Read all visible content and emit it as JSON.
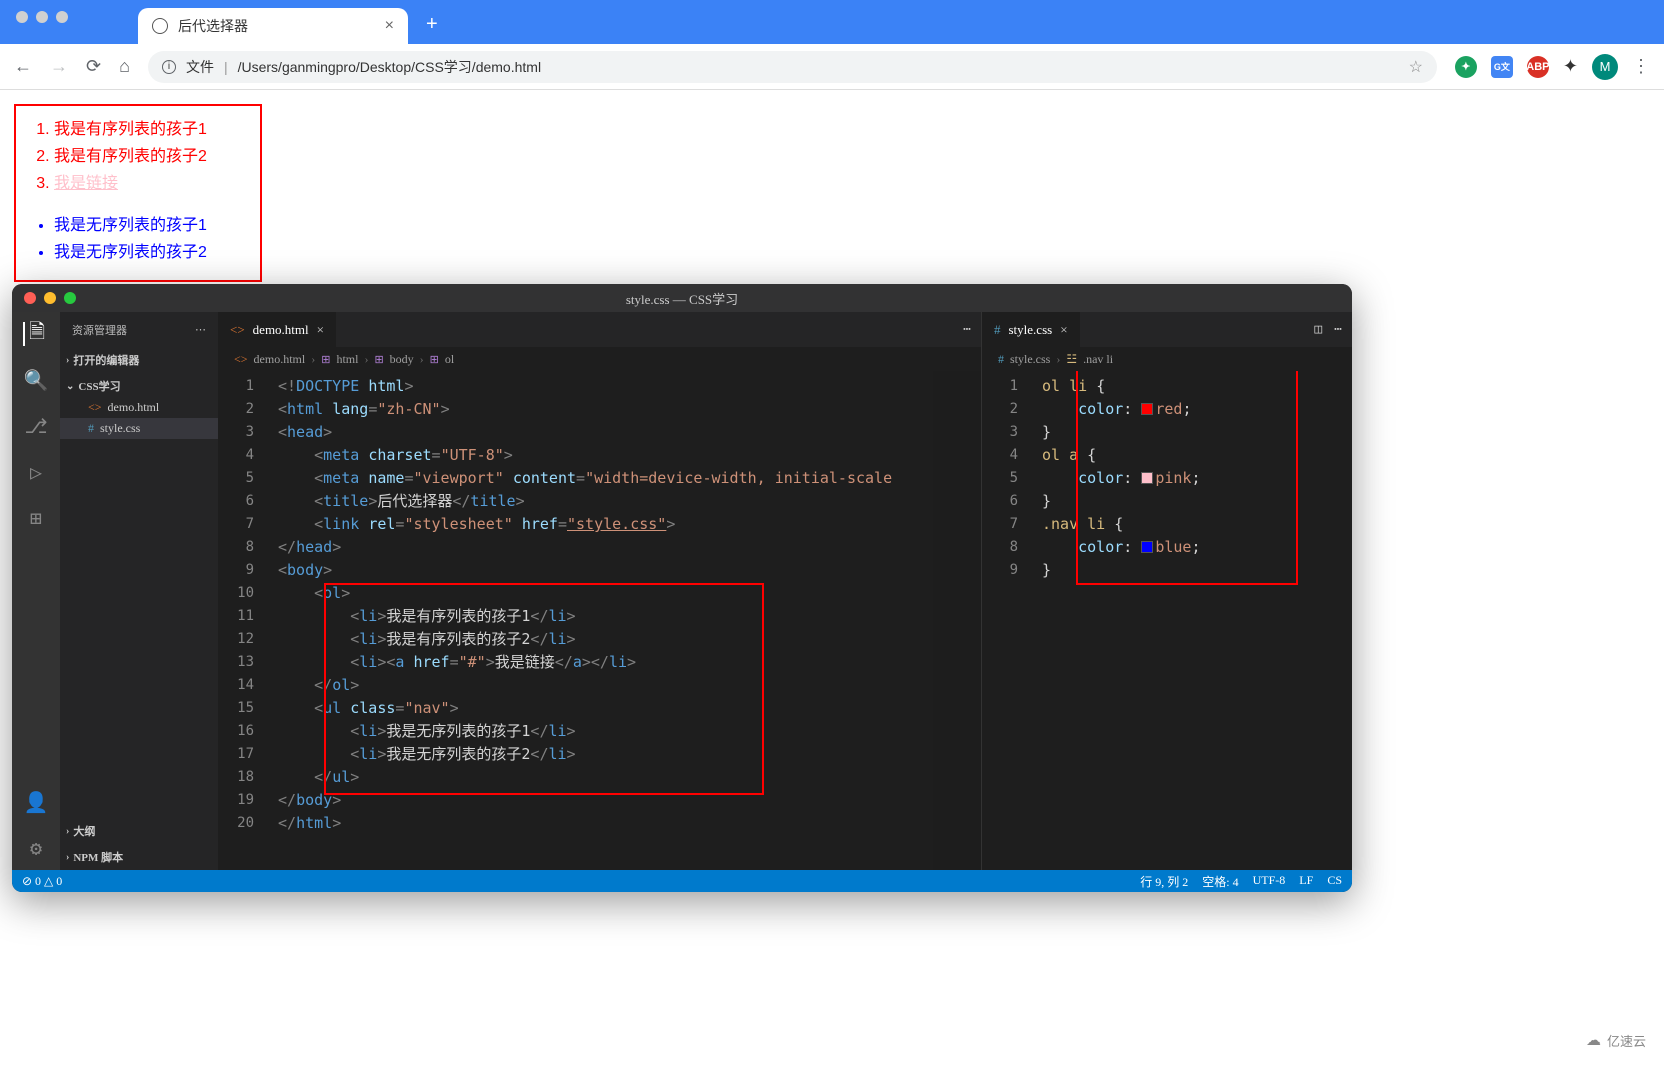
{
  "browser": {
    "tab_title": "后代选择器",
    "url_label": "文件",
    "url_path": "/Users/ganmingpro/Desktop/CSS学习/demo.html",
    "avatar_letter": "M"
  },
  "page": {
    "ol": [
      "我是有序列表的孩子1",
      "我是有序列表的孩子2"
    ],
    "ol_link": "我是链接",
    "ul": [
      "我是无序列表的孩子1",
      "我是无序列表的孩子2"
    ]
  },
  "vscode": {
    "title": "style.css — CSS学习",
    "explorer_label": "资源管理器",
    "open_editors": "打开的编辑器",
    "workspace": "CSS学习",
    "files": [
      "demo.html",
      "style.css"
    ],
    "outline": "大纲",
    "npm": "NPM 脚本",
    "left_tab": "demo.html",
    "right_tab": "style.css",
    "bc_left": [
      "demo.html",
      "html",
      "body",
      "ol"
    ],
    "bc_right": [
      "style.css",
      ".nav li"
    ],
    "html_lines": [
      [
        {
          "t": "punc",
          "v": "<!"
        },
        {
          "t": "doctype",
          "v": "DOCTYPE "
        },
        {
          "t": "attr",
          "v": "html"
        },
        {
          "t": "punc",
          "v": ">"
        }
      ],
      [
        {
          "t": "punc",
          "v": "<"
        },
        {
          "t": "tag",
          "v": "html "
        },
        {
          "t": "attr",
          "v": "lang"
        },
        {
          "t": "punc",
          "v": "="
        },
        {
          "t": "str",
          "v": "\"zh-CN\""
        },
        {
          "t": "punc",
          "v": ">"
        }
      ],
      [
        {
          "t": "punc",
          "v": "<"
        },
        {
          "t": "tag",
          "v": "head"
        },
        {
          "t": "punc",
          "v": ">"
        }
      ],
      [
        {
          "t": "txt",
          "v": "    "
        },
        {
          "t": "punc",
          "v": "<"
        },
        {
          "t": "tag",
          "v": "meta "
        },
        {
          "t": "attr",
          "v": "charset"
        },
        {
          "t": "punc",
          "v": "="
        },
        {
          "t": "str",
          "v": "\"UTF-8\""
        },
        {
          "t": "punc",
          "v": ">"
        }
      ],
      [
        {
          "t": "txt",
          "v": "    "
        },
        {
          "t": "punc",
          "v": "<"
        },
        {
          "t": "tag",
          "v": "meta "
        },
        {
          "t": "attr",
          "v": "name"
        },
        {
          "t": "punc",
          "v": "="
        },
        {
          "t": "str",
          "v": "\"viewport\""
        },
        {
          "t": "txt",
          "v": " "
        },
        {
          "t": "attr",
          "v": "content"
        },
        {
          "t": "punc",
          "v": "="
        },
        {
          "t": "str",
          "v": "\"width=device-width, initial-scale"
        }
      ],
      [
        {
          "t": "txt",
          "v": "    "
        },
        {
          "t": "punc",
          "v": "<"
        },
        {
          "t": "tag",
          "v": "title"
        },
        {
          "t": "punc",
          "v": ">"
        },
        {
          "t": "txt",
          "v": "后代选择器"
        },
        {
          "t": "punc",
          "v": "</"
        },
        {
          "t": "tag",
          "v": "title"
        },
        {
          "t": "punc",
          "v": ">"
        }
      ],
      [
        {
          "t": "txt",
          "v": "    "
        },
        {
          "t": "punc",
          "v": "<"
        },
        {
          "t": "tag",
          "v": "link "
        },
        {
          "t": "attr",
          "v": "rel"
        },
        {
          "t": "punc",
          "v": "="
        },
        {
          "t": "str",
          "v": "\"stylesheet\""
        },
        {
          "t": "txt",
          "v": " "
        },
        {
          "t": "attr",
          "v": "href"
        },
        {
          "t": "punc",
          "v": "="
        },
        {
          "t": "str link-u",
          "v": "\"style.css\""
        },
        {
          "t": "punc",
          "v": ">"
        }
      ],
      [
        {
          "t": "punc",
          "v": "</"
        },
        {
          "t": "tag",
          "v": "head"
        },
        {
          "t": "punc",
          "v": ">"
        }
      ],
      [
        {
          "t": "punc",
          "v": "<"
        },
        {
          "t": "tag",
          "v": "body"
        },
        {
          "t": "punc",
          "v": ">"
        }
      ],
      [
        {
          "t": "txt",
          "v": "    "
        },
        {
          "t": "punc",
          "v": "<"
        },
        {
          "t": "tag",
          "v": "ol"
        },
        {
          "t": "punc",
          "v": ">"
        }
      ],
      [
        {
          "t": "txt",
          "v": "        "
        },
        {
          "t": "punc",
          "v": "<"
        },
        {
          "t": "tag",
          "v": "li"
        },
        {
          "t": "punc",
          "v": ">"
        },
        {
          "t": "txt",
          "v": "我是有序列表的孩子1"
        },
        {
          "t": "punc",
          "v": "</"
        },
        {
          "t": "tag",
          "v": "li"
        },
        {
          "t": "punc",
          "v": ">"
        }
      ],
      [
        {
          "t": "txt",
          "v": "        "
        },
        {
          "t": "punc",
          "v": "<"
        },
        {
          "t": "tag",
          "v": "li"
        },
        {
          "t": "punc",
          "v": ">"
        },
        {
          "t": "txt",
          "v": "我是有序列表的孩子2"
        },
        {
          "t": "punc",
          "v": "</"
        },
        {
          "t": "tag",
          "v": "li"
        },
        {
          "t": "punc",
          "v": ">"
        }
      ],
      [
        {
          "t": "txt",
          "v": "        "
        },
        {
          "t": "punc",
          "v": "<"
        },
        {
          "t": "tag",
          "v": "li"
        },
        {
          "t": "punc",
          "v": "><"
        },
        {
          "t": "tag",
          "v": "a "
        },
        {
          "t": "attr",
          "v": "href"
        },
        {
          "t": "punc",
          "v": "="
        },
        {
          "t": "str",
          "v": "\"#\""
        },
        {
          "t": "punc",
          "v": ">"
        },
        {
          "t": "txt",
          "v": "我是链接"
        },
        {
          "t": "punc",
          "v": "</"
        },
        {
          "t": "tag",
          "v": "a"
        },
        {
          "t": "punc",
          "v": "></"
        },
        {
          "t": "tag",
          "v": "li"
        },
        {
          "t": "punc",
          "v": ">"
        }
      ],
      [
        {
          "t": "txt",
          "v": "    "
        },
        {
          "t": "punc",
          "v": "</"
        },
        {
          "t": "tag",
          "v": "ol"
        },
        {
          "t": "punc",
          "v": ">"
        }
      ],
      [
        {
          "t": "txt",
          "v": "    "
        },
        {
          "t": "punc",
          "v": "<"
        },
        {
          "t": "tag",
          "v": "ul "
        },
        {
          "t": "attr",
          "v": "class"
        },
        {
          "t": "punc",
          "v": "="
        },
        {
          "t": "str",
          "v": "\"nav\""
        },
        {
          "t": "punc",
          "v": ">"
        }
      ],
      [
        {
          "t": "txt",
          "v": "        "
        },
        {
          "t": "punc",
          "v": "<"
        },
        {
          "t": "tag",
          "v": "li"
        },
        {
          "t": "punc",
          "v": ">"
        },
        {
          "t": "txt",
          "v": "我是无序列表的孩子1"
        },
        {
          "t": "punc",
          "v": "</"
        },
        {
          "t": "tag",
          "v": "li"
        },
        {
          "t": "punc",
          "v": ">"
        }
      ],
      [
        {
          "t": "txt",
          "v": "        "
        },
        {
          "t": "punc",
          "v": "<"
        },
        {
          "t": "tag",
          "v": "li"
        },
        {
          "t": "punc",
          "v": ">"
        },
        {
          "t": "txt",
          "v": "我是无序列表的孩子2"
        },
        {
          "t": "punc",
          "v": "</"
        },
        {
          "t": "tag",
          "v": "li"
        },
        {
          "t": "punc",
          "v": ">"
        }
      ],
      [
        {
          "t": "txt",
          "v": "    "
        },
        {
          "t": "punc",
          "v": "</"
        },
        {
          "t": "tag",
          "v": "ul"
        },
        {
          "t": "punc",
          "v": ">"
        }
      ],
      [
        {
          "t": "punc",
          "v": "</"
        },
        {
          "t": "tag",
          "v": "body"
        },
        {
          "t": "punc",
          "v": ">"
        }
      ],
      [
        {
          "t": "punc",
          "v": "</"
        },
        {
          "t": "tag",
          "v": "html"
        },
        {
          "t": "punc",
          "v": ">"
        }
      ]
    ],
    "css_lines": [
      [
        {
          "t": "sel",
          "v": "ol li "
        },
        {
          "t": "txt",
          "v": "{"
        }
      ],
      [
        {
          "t": "txt",
          "v": "    "
        },
        {
          "t": "prop",
          "v": "color"
        },
        {
          "t": "txt",
          "v": ": "
        },
        {
          "sw": "#ff0000"
        },
        {
          "t": "val",
          "v": "red"
        },
        {
          "t": "txt",
          "v": ";"
        }
      ],
      [
        {
          "t": "txt",
          "v": "}"
        }
      ],
      [
        {
          "t": "sel",
          "v": "ol a "
        },
        {
          "t": "txt",
          "v": "{"
        }
      ],
      [
        {
          "t": "txt",
          "v": "    "
        },
        {
          "t": "prop",
          "v": "color"
        },
        {
          "t": "txt",
          "v": ": "
        },
        {
          "sw": "#ffc0cb"
        },
        {
          "t": "val",
          "v": "pink"
        },
        {
          "t": "txt",
          "v": ";"
        }
      ],
      [
        {
          "t": "txt",
          "v": "}"
        }
      ],
      [
        {
          "t": "sel",
          "v": ".nav li "
        },
        {
          "t": "txt",
          "v": "{"
        }
      ],
      [
        {
          "t": "txt",
          "v": "    "
        },
        {
          "t": "prop",
          "v": "color"
        },
        {
          "t": "txt",
          "v": ": "
        },
        {
          "sw": "#0000ff"
        },
        {
          "t": "val",
          "v": "blue"
        },
        {
          "t": "txt",
          "v": ";"
        }
      ],
      [
        {
          "t": "txt",
          "v": "}"
        }
      ]
    ],
    "status": {
      "errors": "⊘ 0 △ 0",
      "pos": "行 9, 列 2",
      "spaces": "空格: 4",
      "enc": "UTF-8",
      "eol": "LF",
      "lang": "CS"
    }
  },
  "watermark": "亿速云"
}
